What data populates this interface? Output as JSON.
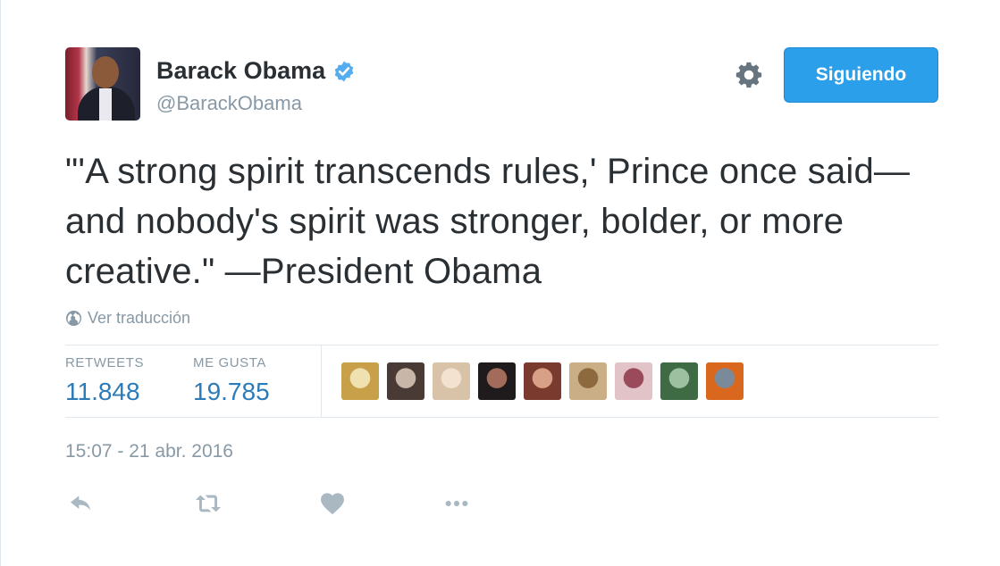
{
  "author": {
    "name": "Barack Obama",
    "handle": "@BarackObama",
    "verified": true
  },
  "header": {
    "follow_label": "Siguiendo"
  },
  "tweet": {
    "text": "\"'A strong spirit transcends rules,' Prince once said—and nobody's spirit was stronger, bolder, or more creative.\" —President Obama",
    "translate_label": "Ver traducción",
    "timestamp": "15:07 - 21 abr. 2016"
  },
  "stats": {
    "retweets_label": "RETWEETS",
    "retweets_value": "11.848",
    "likes_label": "ME GUSTA",
    "likes_value": "19.785"
  },
  "likers": [
    {
      "color": "#c9a04a",
      "accent": "#f0e2b0"
    },
    {
      "color": "#4a3a36",
      "accent": "#c8b7a8"
    },
    {
      "color": "#d8c2a8",
      "accent": "#f3e2d0"
    },
    {
      "color": "#1f1a1c",
      "accent": "#a26b5a"
    },
    {
      "color": "#7a3a2e",
      "accent": "#d9a088"
    },
    {
      "color": "#c9ae86",
      "accent": "#8c6a3e"
    },
    {
      "color": "#e2c4c8",
      "accent": "#9a4a5a"
    },
    {
      "color": "#3f6b44",
      "accent": "#9cc0a0"
    },
    {
      "color": "#d9681e",
      "accent": "#7a8a9a"
    }
  ],
  "colors": {
    "accent": "#2b9fea",
    "text": "#292f33",
    "muted": "#8899a6",
    "link": "#2b7bb9",
    "verified": "#55acee"
  },
  "icons": {
    "verified": "verified-badge-icon",
    "settings": "gear-icon",
    "translate": "globe-icon",
    "reply": "reply-icon",
    "retweet": "retweet-icon",
    "like": "heart-icon",
    "more": "more-dots-icon"
  }
}
